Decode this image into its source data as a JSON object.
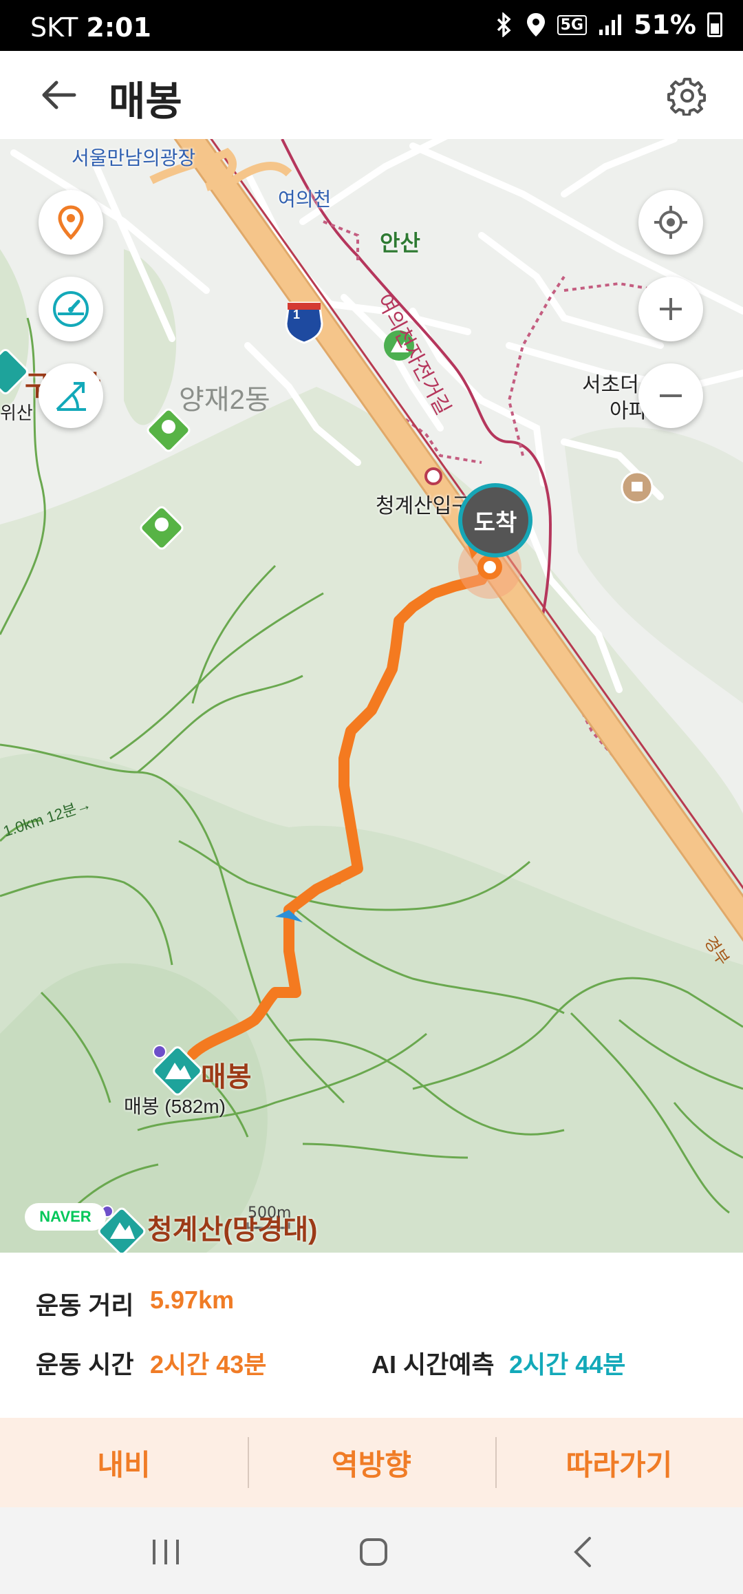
{
  "status": {
    "carrier": "SKT",
    "time": "2:01",
    "network": "5G",
    "battery": "51%"
  },
  "header": {
    "title": "매봉"
  },
  "map": {
    "labels": {
      "plaza": "서울만남의광장",
      "stream": "여의천",
      "mountain_ansan": "안산",
      "bike_road": "여의천자전거길",
      "station": "청계산입구",
      "apartment": "서초더",
      "apartment2": "아파",
      "yangjae": "양재2동",
      "guryong": "구룡산",
      "guryong_sub": "위산",
      "maebong": "매봉",
      "maebong_height": "매봉 (582m)",
      "cheonggye": "청계산(망경대)",
      "trail_hint": "1.0km 12분→",
      "edge_label": "경부",
      "highway_num": "1"
    },
    "arrive_badge": "도착",
    "naver_logo": "NAVER",
    "scale": "500m"
  },
  "panel": {
    "distance_label": "운동 거리",
    "distance_value": "5.97km",
    "time_label": "운동 시간",
    "time_value": "2시간 43분",
    "ai_label": "AI 시간예측",
    "ai_value": "2시간 44분"
  },
  "actions": {
    "navi": "내비",
    "reverse": "역방향",
    "follow": "따라가기"
  },
  "colors": {
    "route": "#f47a20",
    "accent_orange": "#f07c26",
    "accent_teal": "#13a9b9",
    "highway": "#f5c58a",
    "trail": "#b5365c"
  }
}
